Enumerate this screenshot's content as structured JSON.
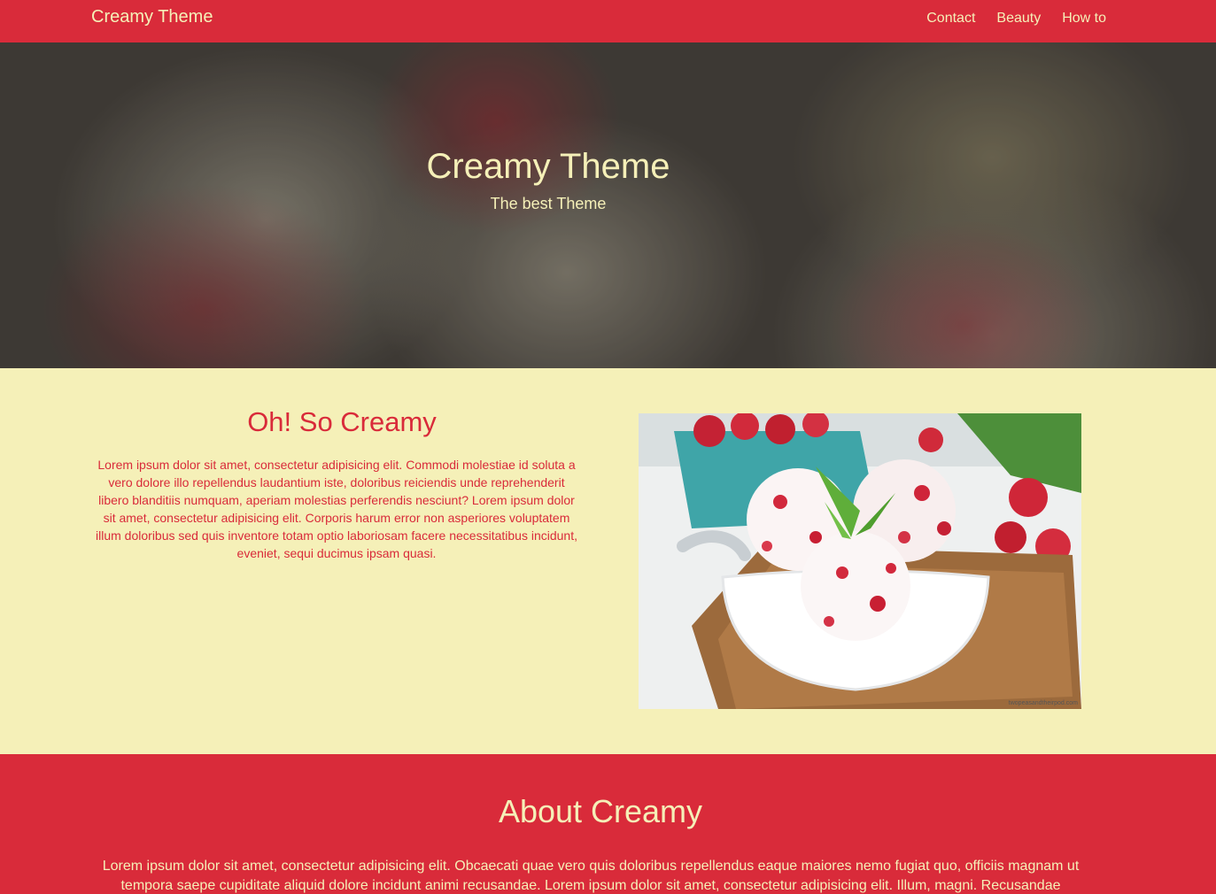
{
  "navbar": {
    "brand": "Creamy Theme",
    "links": [
      "Contact",
      "Beauty",
      "How to"
    ]
  },
  "hero": {
    "title": "Creamy Theme",
    "subtitle": "The best Theme"
  },
  "creamy": {
    "heading": "Oh! So Creamy",
    "text": "Lorem ipsum dolor sit amet, consectetur adipisicing elit. Commodi molestiae id soluta a vero dolore illo repellendus laudantium iste, doloribus reiciendis unde reprehenderit libero blanditiis numquam, aperiam molestias perferendis nesciunt? Lorem ipsum dolor sit amet, consectetur adipisicing elit. Corporis harum error non asperiores voluptatem illum doloribus sed quis inventore totam optio laboriosam facere necessitatibus incidunt, eveniet, sequi ducimus ipsam quasi.",
    "photo_credit": "twopeasandtheirpod.com"
  },
  "about": {
    "heading": "About Creamy",
    "text": "Lorem ipsum dolor sit amet, consectetur adipisicing elit. Obcaecati quae vero quis doloribus repellendus eaque maiores nemo fugiat quo, officiis magnam ut tempora saepe cupiditate aliquid dolore incidunt animi recusandae. Lorem ipsum dolor sit amet, consectetur adipisicing elit. Illum, magni. Recusandae"
  },
  "colors": {
    "brand_red": "#d92b3a",
    "cream": "#f5f0b8"
  }
}
